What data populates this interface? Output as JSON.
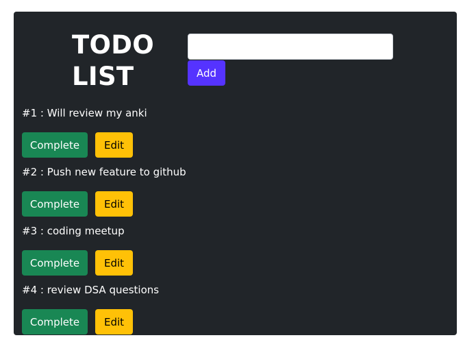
{
  "header": {
    "title_line1": "TODO",
    "title_line2": "LIST"
  },
  "form": {
    "input_value": "",
    "input_placeholder": "",
    "add_label": "Add"
  },
  "todos": [
    {
      "text": "#1 : Will review my anki",
      "complete_label": "Complete",
      "edit_label": "Edit"
    },
    {
      "text": "#2 : Push new feature to github",
      "complete_label": "Complete",
      "edit_label": "Edit"
    },
    {
      "text": "#3 : coding meetup",
      "complete_label": "Complete",
      "edit_label": "Edit"
    },
    {
      "text": "#4 : review DSA questions",
      "complete_label": "Complete",
      "edit_label": "Edit"
    }
  ],
  "colors": {
    "card_background": "#212529",
    "add_button": "#5533ff",
    "complete_button": "#198754",
    "edit_button": "#ffc107"
  }
}
